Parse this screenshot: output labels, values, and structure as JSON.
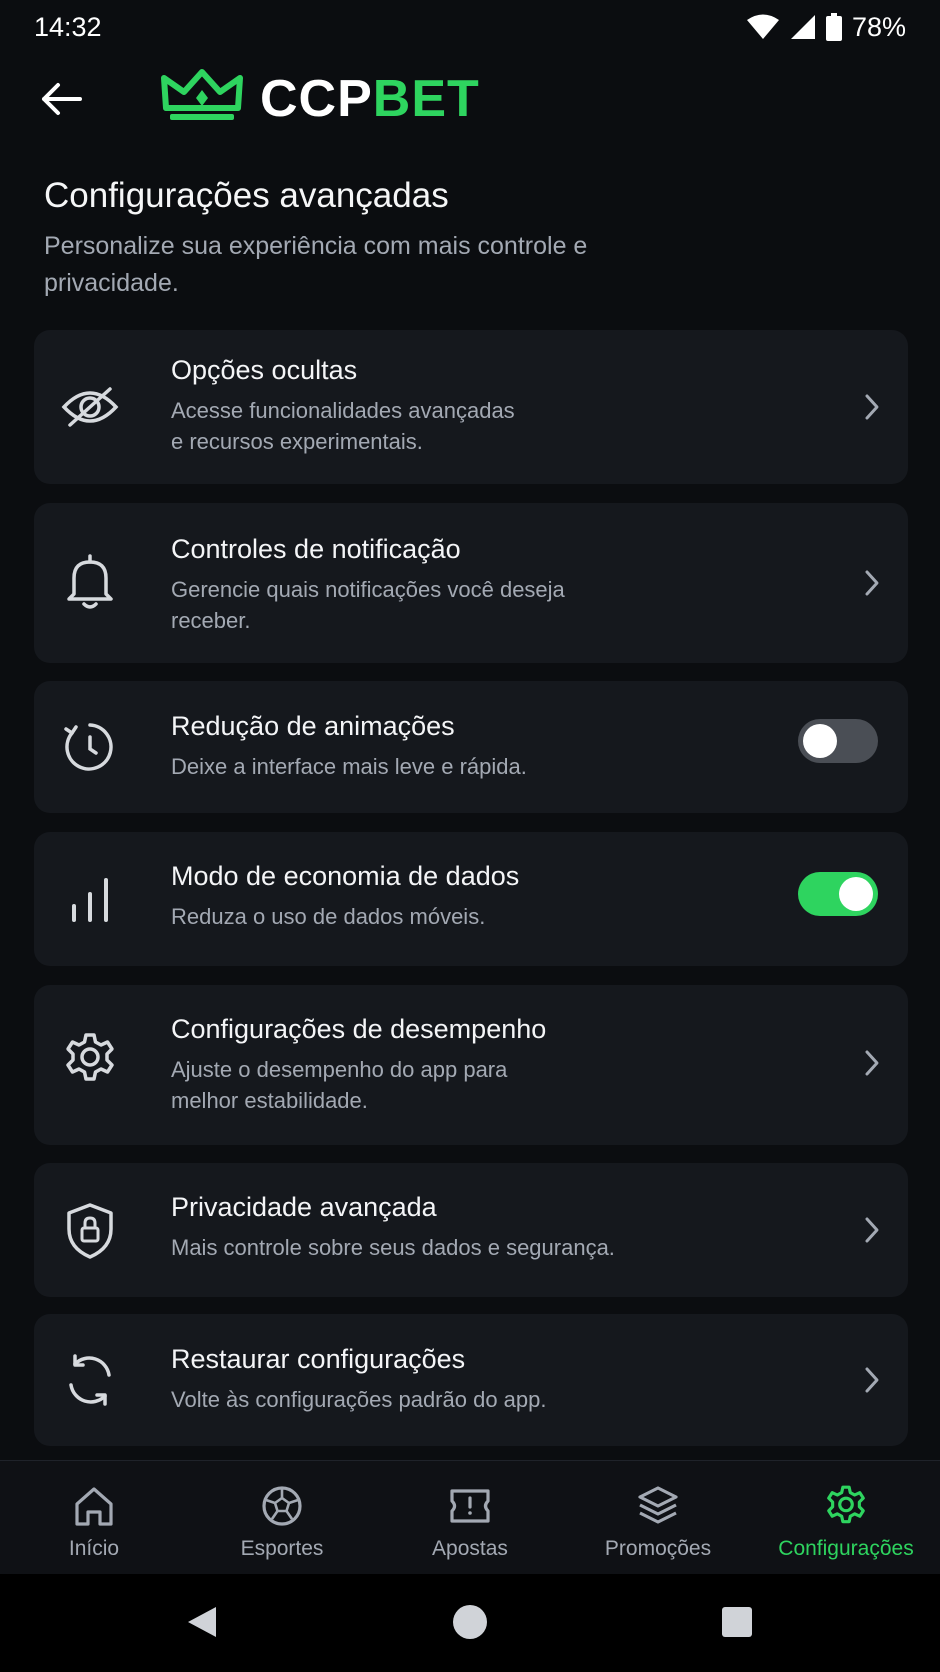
{
  "status_bar": {
    "time": "14:32",
    "battery": "78%"
  },
  "header": {
    "logo_primary": "CCP",
    "logo_accent": "BET"
  },
  "page": {
    "title": "Configurações avançadas",
    "subtitle": "Personalize sua experiência com mais controle e privacidade."
  },
  "settings": [
    {
      "title": "Opções ocultas",
      "desc_line1": "Acesse funcionalidades avançadas",
      "desc_line2": "e recursos experimentais.",
      "icon": "eye-off-icon",
      "control": "chevron"
    },
    {
      "title": "Controles de notificação",
      "desc_line1": "Gerencie quais notificações você deseja",
      "desc_line2": "receber.",
      "icon": "bell-icon",
      "control": "chevron"
    },
    {
      "title": "Redução de animações",
      "desc_line1": "Deixe a interface mais leve e rápida.",
      "icon": "timer-icon",
      "control": "toggle",
      "enabled": false
    },
    {
      "title": "Modo de economia de dados",
      "desc_line1": "Reduza o uso de dados móveis.",
      "icon": "signal-bars-icon",
      "control": "toggle",
      "enabled": true
    },
    {
      "title": "Configurações de desempenho",
      "desc_line1": "Ajuste o desempenho do app para",
      "desc_line2": "melhor estabilidade.",
      "icon": "gear-icon",
      "control": "chevron"
    },
    {
      "title": "Privacidade avançada",
      "desc_line1": "Mais controle sobre seus dados e segurança.",
      "icon": "shield-lock-icon",
      "control": "chevron"
    },
    {
      "title": "Restaurar configurações",
      "desc_line1": "Volte às configurações padrão do app.",
      "icon": "refresh-icon",
      "control": "chevron"
    }
  ],
  "bottom_nav": {
    "items": [
      {
        "label": "Início",
        "icon": "home-icon"
      },
      {
        "label": "Esportes",
        "icon": "soccer-ball-icon"
      },
      {
        "label": "Apostas",
        "icon": "ticket-icon"
      },
      {
        "label": "Promoções",
        "icon": "layers-icon"
      },
      {
        "label": "Configurações",
        "icon": "gear-icon",
        "active": true
      }
    ]
  },
  "colors": {
    "accent": "#2ed45f",
    "background": "#0b0d10",
    "card": "#15181d",
    "muted_text": "#a3a9b3"
  }
}
